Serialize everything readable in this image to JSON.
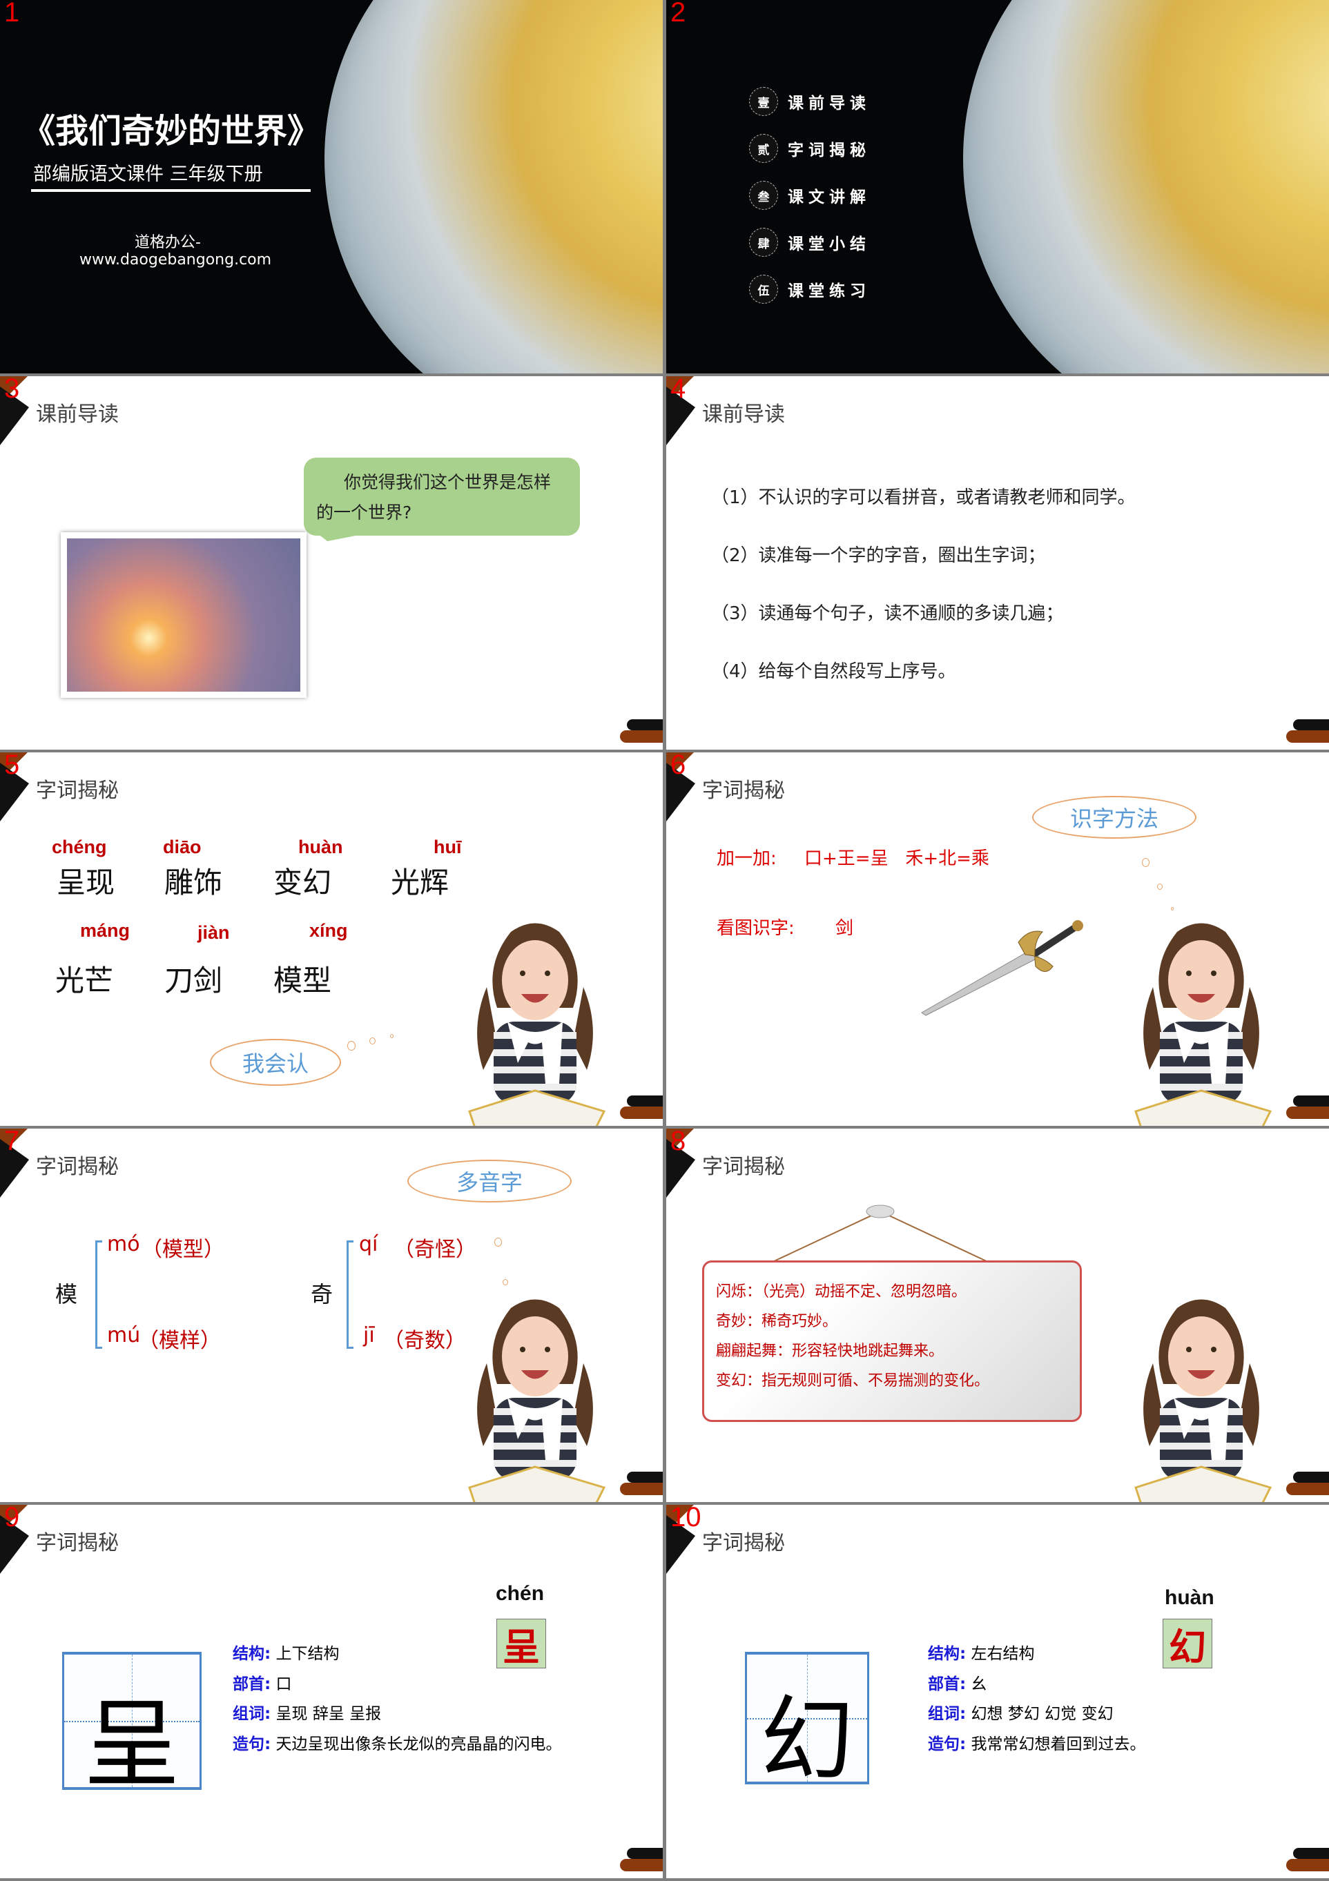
{
  "slides": [
    {
      "num": "1",
      "title": "《我们奇妙的世界》",
      "subtitle": "部编版语文课件  三年级下册",
      "brand": "道格办公-",
      "url": "www.daogebangong.com"
    },
    {
      "num": "2",
      "menu": [
        {
          "badge": "壹",
          "label": "课前导读"
        },
        {
          "badge": "贰",
          "label": "字词揭秘"
        },
        {
          "badge": "叁",
          "label": "课文讲解"
        },
        {
          "badge": "肆",
          "label": "课堂小结"
        },
        {
          "badge": "伍",
          "label": "课堂练习"
        }
      ]
    },
    {
      "num": "3",
      "title": "课前导读",
      "bubble": "你觉得我们这个世界是怎样的一个世界?"
    },
    {
      "num": "4",
      "title": "课前导读",
      "items": [
        "（1）不认识的字可以看拼音，或者请教老师和同学。",
        "（2）读准每一个字的字音，圈出生字词；",
        "（3）读通每个句子，读不通顺的多读几遍；",
        "（4）给每个自然段写上序号。"
      ]
    },
    {
      "num": "5",
      "title": "字词揭秘",
      "words": [
        {
          "pinyin": "chéng",
          "word": "呈现"
        },
        {
          "pinyin": "diāo",
          "word": "雕饰"
        },
        {
          "pinyin": "huàn",
          "word": "变幻"
        },
        {
          "pinyin": "huī",
          "word": "光辉"
        },
        {
          "pinyin": "máng",
          "word": "光芒"
        },
        {
          "pinyin": "jiàn",
          "word": "刀剑"
        },
        {
          "pinyin": "xíng",
          "word": "模型"
        }
      ],
      "cloud": "我会认"
    },
    {
      "num": "6",
      "title": "字词揭秘",
      "cloud": "识字方法",
      "add_label": "加一加:",
      "add_formula": "口+王=呈   禾+北=乘",
      "pic_label": "看图识字:",
      "pic_char": "剑"
    },
    {
      "num": "7",
      "title": "字词揭秘",
      "cloud": "多音字",
      "groups": [
        {
          "char": "模",
          "readings": [
            {
              "pinyin": "mó",
              "word": "（模型）"
            },
            {
              "pinyin": "mú",
              "word": "（模样）"
            }
          ]
        },
        {
          "char": "奇",
          "readings": [
            {
              "pinyin": "qí",
              "word": "（奇怪）"
            },
            {
              "pinyin": "jī",
              "word": "（奇数）"
            }
          ]
        }
      ]
    },
    {
      "num": "8",
      "title": "字词揭秘",
      "board": [
        "闪烁：（光亮）动摇不定、忽明忽暗。",
        "奇妙：稀奇巧妙。",
        "翩翩起舞：形容轻快地跳起舞来。",
        "变幻：指无规则可循、不易揣测的变化。"
      ]
    },
    {
      "num": "9",
      "title": "字词揭秘",
      "char": "呈",
      "pinyin": "chén",
      "rows": [
        {
          "label": "结构:",
          "value": "上下结构"
        },
        {
          "label": "部首:",
          "value": "口"
        },
        {
          "label": "组词:",
          "value": "呈现 辞呈 呈报"
        },
        {
          "label": "造句:",
          "value": "天边呈现出像条长龙似的亮晶晶的闪电。"
        }
      ]
    },
    {
      "num": "10",
      "title": "字词揭秘",
      "char": "幻",
      "pinyin": "huàn",
      "rows": [
        {
          "label": "结构:",
          "value": "左右结构"
        },
        {
          "label": "部首:",
          "value": "幺"
        },
        {
          "label": "组词:",
          "value": "幻想 梦幻 幻觉 变幻"
        },
        {
          "label": "造句:",
          "value": "我常常幻想着回到过去。"
        }
      ]
    }
  ],
  "colors": {
    "accent_red": "#d00000",
    "pinyin_red": "#c00000",
    "label_blue": "#1a1ad6",
    "cloud_text": "#5b9bd5",
    "bubble_green": "#a9d18e",
    "brown": "#8b3a0e"
  }
}
